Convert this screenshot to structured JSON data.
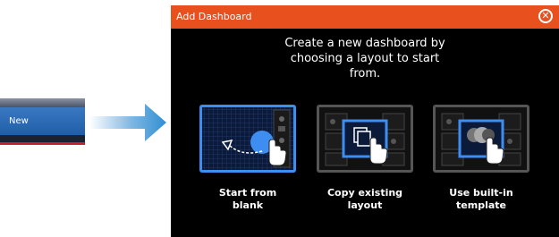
{
  "menu": {
    "new_label": "New"
  },
  "dialog": {
    "title": "Add Dashboard",
    "close_icon": "close-icon",
    "heading_line1": "Create a new dashboard by",
    "heading_line2": "choosing a layout to start",
    "heading_line3": "from.",
    "options": [
      {
        "label_line1": "Start from",
        "label_line2": "blank",
        "icon": "blank-layout-icon"
      },
      {
        "label_line1": "Copy existing",
        "label_line2": "layout",
        "icon": "copy-layout-icon"
      },
      {
        "label_line1": "Use built-in",
        "label_line2": "template",
        "icon": "template-icon"
      }
    ]
  },
  "colors": {
    "titlebar": "#e8501e",
    "accent_blue": "#2f7fe0",
    "menu_blue": "#2a6bb8"
  }
}
